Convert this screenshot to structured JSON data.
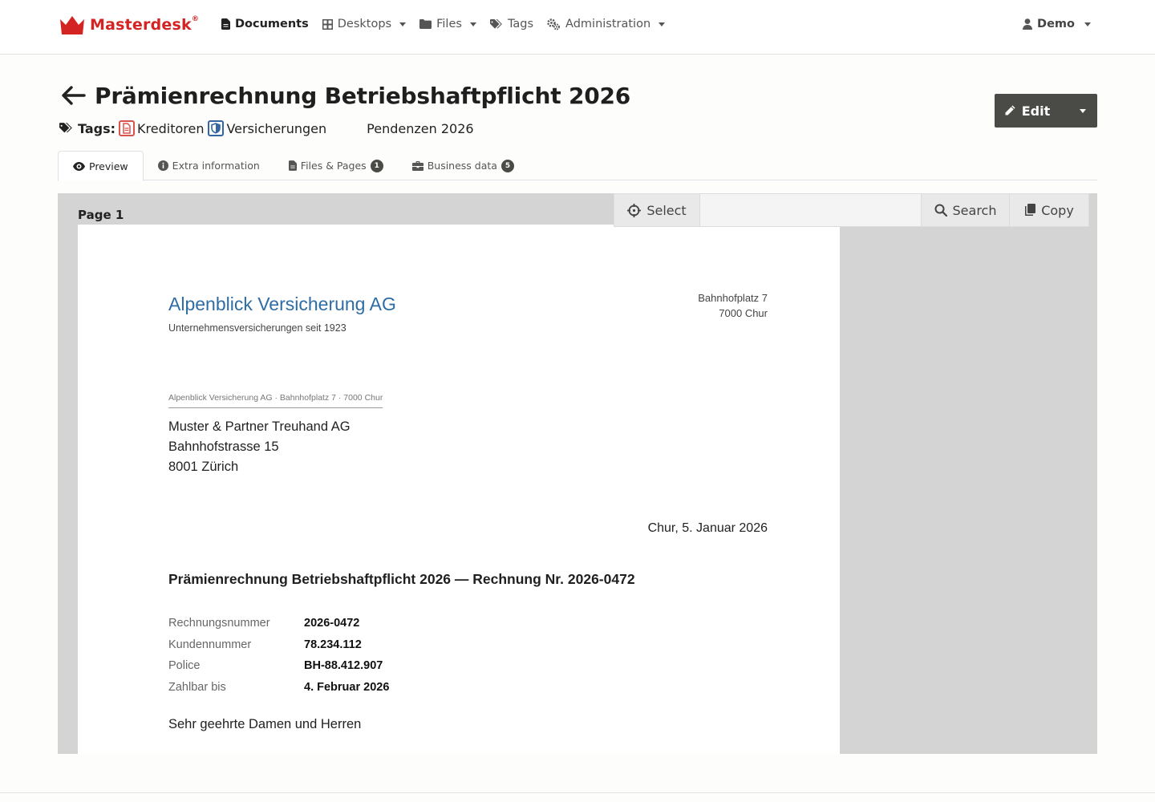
{
  "brand": {
    "name": "Masterdesk",
    "mark": "®",
    "color": "#d42323"
  },
  "nav": {
    "items": [
      {
        "label": "Documents",
        "icon": "document-icon",
        "active": true,
        "dropdown": false
      },
      {
        "label": "Desktops",
        "icon": "grid-icon",
        "active": false,
        "dropdown": true
      },
      {
        "label": "Files",
        "icon": "folder-icon",
        "active": false,
        "dropdown": true
      },
      {
        "label": "Tags",
        "icon": "tags-icon",
        "active": false,
        "dropdown": false
      },
      {
        "label": "Administration",
        "icon": "gears-icon",
        "active": false,
        "dropdown": true
      }
    ],
    "user": "Demo"
  },
  "header": {
    "title": "Prämienrechnung Betriebshaftpflicht 2026",
    "tags_label": "Tags:",
    "tags": [
      {
        "label": "Kreditoren",
        "icon": "pdf-doc-icon",
        "color": "#d9534f"
      },
      {
        "label": "Versicherungen",
        "icon": "shield-icon",
        "color": "#3465a4"
      }
    ],
    "extra_tag": "Pendenzen 2026",
    "edit_label": "Edit"
  },
  "tabs": [
    {
      "label": "Preview",
      "icon": "eye-icon",
      "active": true
    },
    {
      "label": "Extra information",
      "icon": "info-icon",
      "active": false
    },
    {
      "label": "Files & Pages",
      "icon": "file-icon",
      "badge": "1",
      "active": false
    },
    {
      "label": "Business data",
      "icon": "briefcase-icon",
      "badge": "5",
      "active": false
    }
  ],
  "viewer": {
    "page_label": "Page 1",
    "select_label": "Select",
    "search_label": "Search",
    "copy_label": "Copy"
  },
  "document": {
    "company": "Alpenblick Versicherung AG",
    "company_sub": "Unternehmensversicherungen seit 1923",
    "address_line1": "Bahnhofplatz 7",
    "address_line2": "7000 Chur",
    "sender_line": "Alpenblick Versicherung AG · Bahnhofplatz 7 · 7000 Chur",
    "recipient": {
      "line1": "Muster & Partner Treuhand AG",
      "line2": "Bahnhofstrasse 15",
      "line3": "8001 Zürich"
    },
    "date": "Chur, 5. Januar 2026",
    "heading": "Prämienrechnung Betriebshaftpflicht 2026 — Rechnung Nr. 2026-0472",
    "info": [
      {
        "key": "Rechnungsnummer",
        "value": "2026-0472"
      },
      {
        "key": "Kundennummer",
        "value": "78.234.112"
      },
      {
        "key": "Police",
        "value": "BH-88.412.907"
      },
      {
        "key": "Zahlbar bis",
        "value": "4. Februar 2026"
      }
    ],
    "salutation": "Sehr geehrte Damen und Herren"
  }
}
